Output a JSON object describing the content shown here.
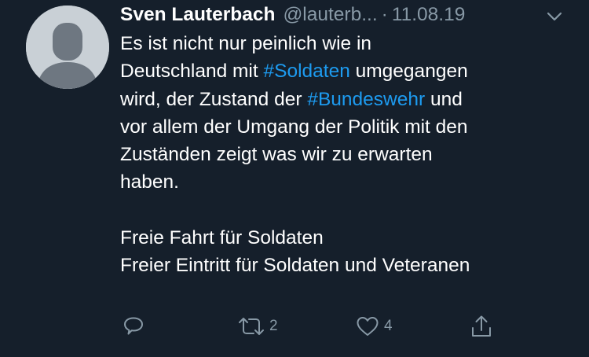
{
  "tweet": {
    "author_name": "Sven Lauterbach",
    "handle": "@lauterb...",
    "separator": "·",
    "date": "11.08.19",
    "text": {
      "line1": "Es ist nicht nur peinlich wie in",
      "line2_before": "Deutschland mit ",
      "hashtag_soldaten": "#Soldaten",
      "line2_after": " umgegangen",
      "line3_before": "wird, der Zustand der ",
      "hashtag_bundeswehr": "#Bundeswehr",
      "line3_after": " und",
      "line4": "vor allem der Umgang der Politik mit den",
      "line5": "Zuständen zeigt was wir zu erwarten",
      "line6": "haben.",
      "line7": "Freie Fahrt für Soldaten",
      "line8": "Freier Eintritt für Soldaten und Veteranen"
    },
    "actions": {
      "reply_icon": "reply-icon",
      "retweet_icon": "retweet-icon",
      "retweet_count": "2",
      "like_icon": "heart-icon",
      "like_count": "4",
      "share_icon": "share-icon"
    }
  },
  "colors": {
    "background": "#151f2b",
    "text": "#ffffff",
    "secondary": "#8899a6",
    "link": "#1d9bf0",
    "avatar": "#c9d0d6"
  }
}
